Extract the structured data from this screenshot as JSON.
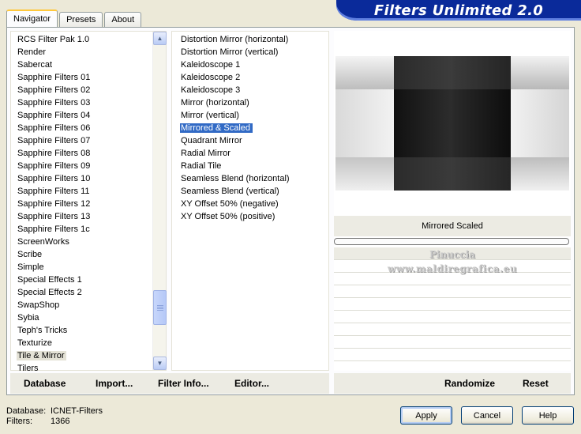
{
  "tabs": [
    "Navigator",
    "Presets",
    "About"
  ],
  "app_title": "Filters Unlimited 2.0",
  "categories": {
    "items": [
      "RCS Filter Pak 1.0",
      "Render",
      "Sabercat",
      "Sapphire Filters 01",
      "Sapphire Filters 02",
      "Sapphire Filters 03",
      "Sapphire Filters 04",
      "Sapphire Filters 06",
      "Sapphire Filters 07",
      "Sapphire Filters 08",
      "Sapphire Filters 09",
      "Sapphire Filters 10",
      "Sapphire Filters 11",
      "Sapphire Filters 12",
      "Sapphire Filters 13",
      "Sapphire Filters 1c",
      "ScreenWorks",
      "Scribe",
      "Simple",
      "Special Effects 1",
      "Special Effects 2",
      "SwapShop",
      "Sybia",
      "Teph's Tricks",
      "Texturize",
      "Tile & Mirror",
      "Tilers"
    ],
    "selected": "Tile & Mirror"
  },
  "filters": {
    "items": [
      "Distortion Mirror (horizontal)",
      "Distortion Mirror (vertical)",
      "Kaleidoscope 1",
      "Kaleidoscope 2",
      "Kaleidoscope 3",
      "Mirror (horizontal)",
      "Mirror (vertical)",
      "Mirrored & Scaled",
      "Quadrant Mirror",
      "Radial Mirror",
      "Radial Tile",
      "Seamless Blend (horizontal)",
      "Seamless Blend (vertical)",
      "XY Offset 50% (negative)",
      "XY Offset 50% (positive)"
    ],
    "selected": "Mirrored & Scaled"
  },
  "preview": {
    "filter_name": "Mirrored  Scaled",
    "watermark_line1": "Pinuccia",
    "watermark_line2": "www.maldiregrafica.eu"
  },
  "bottom_buttons": {
    "database": "Database",
    "import": "Import...",
    "filter_info": "Filter Info...",
    "editor": "Editor...",
    "randomize": "Randomize",
    "reset": "Reset"
  },
  "status": {
    "database_label": "Database:",
    "database_value": "ICNET-Filters",
    "filters_label": "Filters:",
    "filters_value": "1366"
  },
  "dialog_buttons": {
    "apply": "Apply",
    "cancel": "Cancel",
    "help": "Help"
  },
  "colors": {
    "selection": "#316ac5",
    "banner": "#0a2a9a"
  },
  "icons": {
    "scroll_up": "chevron-up-icon",
    "scroll_down": "chevron-down-icon"
  }
}
